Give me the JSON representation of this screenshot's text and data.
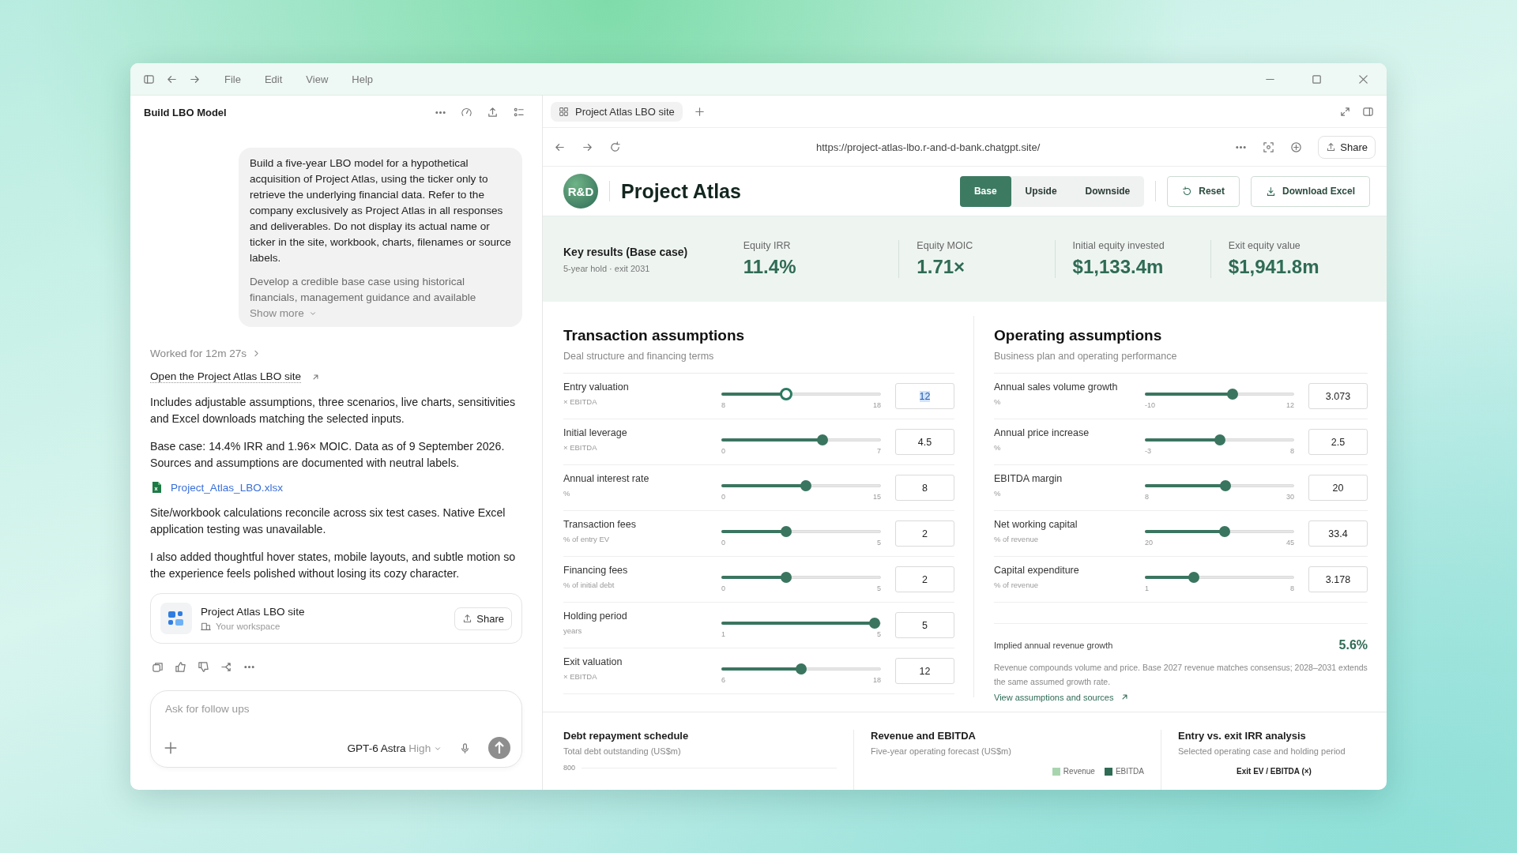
{
  "window": {
    "menu": [
      "File",
      "Edit",
      "View",
      "Help"
    ]
  },
  "chat": {
    "title": "Build LBO Model",
    "prompt": [
      "Build a five-year LBO model for a hypothetical acquisition of Project Atlas, using the ticker only to retrieve the underlying financial data. Refer to the company exclusively as Project Atlas in all responses and deliverables. Do not display its actual name or ticker in the site, workbook, charts, filenames or source labels.",
      "Develop a credible base case using historical financials, management guidance and available"
    ],
    "show_more": "Show more",
    "worked": "Worked for 12m 27s",
    "site_link": "Open the Project Atlas LBO site",
    "blocks": [
      {
        "kind": "text",
        "text": "Includes adjustable assumptions, three scenarios, live charts, sensitivities and Excel downloads matching the selected inputs."
      },
      {
        "kind": "text",
        "text": "Base case: 14.4% IRR and 1.96× MOIC. Data as of 9 September 2026. Sources and assumptions are documented with neutral labels."
      },
      {
        "kind": "file",
        "text": "Project_Atlas_LBO.xlsx"
      },
      {
        "kind": "text",
        "text": "Site/workbook calculations reconcile across six test cases. Native Excel application testing was unavailable."
      },
      {
        "kind": "text",
        "text": "I also added thoughtful hover states, mobile layouts, and subtle motion so the experience feels polished without losing its cozy character."
      }
    ],
    "card": {
      "title": "Project Atlas LBO site",
      "subtitle": "Your workspace",
      "button": "Share"
    },
    "composer": {
      "placeholder": "Ask for follow ups",
      "model": "GPT-6 Astra",
      "effort": "High"
    }
  },
  "browser": {
    "tab": "Project Atlas LBO site",
    "url": "https://project-atlas-lbo.r-and-d-bank.chatgpt.site/",
    "share": "Share"
  },
  "site": {
    "logo": "R&D",
    "title": "Project Atlas",
    "scenarios": [
      {
        "label": "Base",
        "selected": true
      },
      {
        "label": "Upside",
        "selected": false
      },
      {
        "label": "Downside",
        "selected": false
      }
    ],
    "reset": "Reset",
    "download": "Download Excel"
  },
  "results": {
    "title": "Key results (Base case)",
    "subtitle": "5-year hold · exit 2031",
    "metrics": [
      {
        "label": "Equity IRR",
        "value": "11.4%"
      },
      {
        "label": "Equity MOIC",
        "value": "1.71×"
      },
      {
        "label": "Initial equity invested",
        "value": "$1,133.4m"
      },
      {
        "label": "Exit equity value",
        "value": "$1,941.8m"
      }
    ]
  },
  "sections": [
    {
      "title": "Transaction assumptions",
      "subtitle": "Deal structure and financing terms",
      "sliders": [
        {
          "label": "Entry valuation",
          "unit": "× EBITDA",
          "min": "8",
          "max": "18",
          "value": "12",
          "level": 0.4,
          "active": true
        },
        {
          "label": "Initial leverage",
          "unit": "× EBITDA",
          "min": "0",
          "max": "7",
          "value": "4.5",
          "level": 0.643,
          "active": false
        },
        {
          "label": "Annual interest rate",
          "unit": "%",
          "min": "0",
          "max": "15",
          "value": "8",
          "level": 0.533,
          "active": false
        },
        {
          "label": "Transaction fees",
          "unit": "% of entry EV",
          "min": "0",
          "max": "5",
          "value": "2",
          "level": 0.4,
          "active": false
        },
        {
          "label": "Financing fees",
          "unit": "% of initial debt",
          "min": "0",
          "max": "5",
          "value": "2",
          "level": 0.4,
          "active": false
        },
        {
          "label": "Holding period",
          "unit": "years",
          "min": "1",
          "max": "5",
          "value": "5",
          "level": 1,
          "active": false
        },
        {
          "label": "Exit valuation",
          "unit": "× EBITDA",
          "min": "6",
          "max": "18",
          "value": "12",
          "level": 0.5,
          "active": false
        }
      ]
    },
    {
      "title": "Operating assumptions",
      "subtitle": "Business plan and operating performance",
      "sliders": [
        {
          "label": "Annual sales volume growth",
          "unit": "%",
          "min": "-10",
          "max": "12",
          "value": "3.073",
          "level": 0.594,
          "active": false
        },
        {
          "label": "Annual price increase",
          "unit": "%",
          "min": "-3",
          "max": "8",
          "value": "2.5",
          "level": 0.5,
          "active": false
        },
        {
          "label": "EBITDA margin",
          "unit": "%",
          "min": "8",
          "max": "30",
          "value": "20",
          "level": 0.545,
          "active": false
        },
        {
          "label": "Net working capital",
          "unit": "% of revenue",
          "min": "20",
          "max": "45",
          "value": "33.4",
          "level": 0.536,
          "active": false
        },
        {
          "label": "Capital expenditure",
          "unit": "% of revenue",
          "min": "1",
          "max": "8",
          "value": "3.178",
          "level": 0.311,
          "active": false
        }
      ],
      "summary": {
        "label": "Implied annual revenue growth",
        "value": "5.6%",
        "note": "Revenue compounds volume and price. Base 2027 revenue matches consensus; 2028–2031 extends the same assumed growth rate.",
        "link": "View assumptions and sources"
      }
    }
  ],
  "charts": [
    {
      "title": "Debt repayment schedule",
      "subtitle": "Total debt outstanding (US$m)",
      "axis_label": "800"
    },
    {
      "title": "Revenue and EBITDA",
      "subtitle": "Five-year operating forecast (US$m)",
      "legend": [
        {
          "name": "Revenue",
          "color": "#a8d5b0"
        },
        {
          "name": "EBITDA",
          "color": "#2f6b55"
        }
      ]
    },
    {
      "title": "Entry vs. exit IRR analysis",
      "subtitle": "Selected operating case and holding period",
      "axis_title": "Exit EV / EBITDA (×)"
    }
  ]
}
